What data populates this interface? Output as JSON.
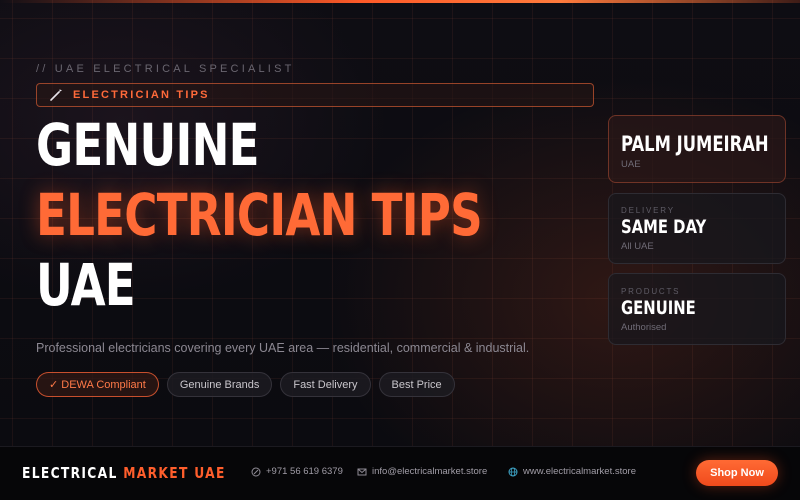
{
  "hero": {
    "eyebrow": "// UAE ELECTRICAL SPECIALIST",
    "tag": {
      "icon": "wand-icon",
      "label": "ELECTRICIAN TIPS"
    },
    "headline": {
      "line1": "GENUINE",
      "line2": "ELECTRICIAN TIPS",
      "line3": "UAE"
    },
    "subtitle": "Professional electricians covering every UAE area — residential, commercial & industrial.",
    "chips": [
      {
        "label": "✓ DEWA Compliant",
        "active": true
      },
      {
        "label": "Genuine Brands",
        "active": false
      },
      {
        "label": "Fast Delivery",
        "active": false
      },
      {
        "label": "Best Price",
        "active": false
      }
    ]
  },
  "cards": [
    {
      "kicker": "",
      "value": "PALM JUMEIRAH",
      "sub": "UAE"
    },
    {
      "kicker": "DELIVERY",
      "value": "SAME DAY",
      "sub": "All UAE"
    },
    {
      "kicker": "PRODUCTS",
      "value": "GENUINE",
      "sub": "Authorised"
    }
  ],
  "footer": {
    "brand_white": "ELECTRICAL",
    "brand_orange": "MARKET UAE",
    "phone": "+971 56 619 6379",
    "email": "info@electricalmarket.store",
    "website": "www.electricalmarket.store",
    "shop_button": "Shop Now"
  },
  "colors": {
    "accent": "#ff6a36",
    "background": "#0b0b10"
  }
}
